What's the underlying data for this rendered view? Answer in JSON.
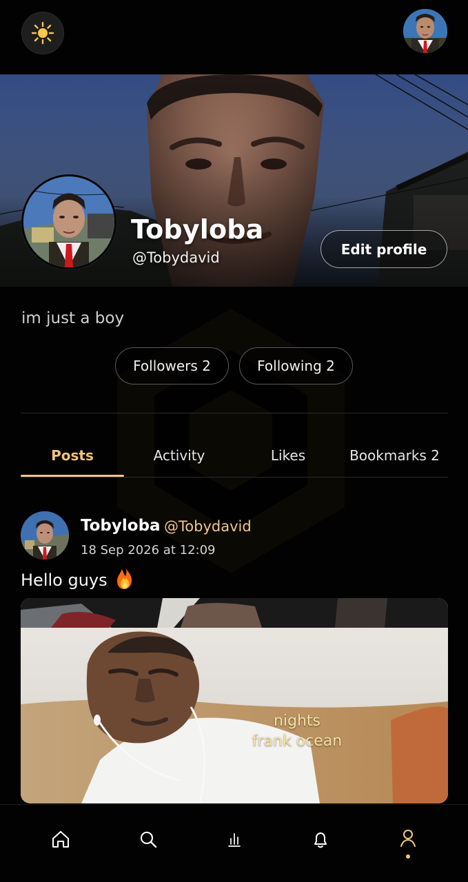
{
  "profile": {
    "display_name": "Tobyloba",
    "handle": "@Tobydavid",
    "bio": "im just a boy",
    "edit_label": "Edit profile",
    "followers_label": "Followers 2",
    "following_label": "Following 2"
  },
  "tabs": [
    {
      "label": "Posts",
      "active": true
    },
    {
      "label": "Activity",
      "active": false
    },
    {
      "label": "Likes",
      "active": false
    },
    {
      "label": "Bookmarks 2",
      "active": false
    }
  ],
  "post": {
    "author": "Tobyloba",
    "handle": "@Tobydavid",
    "timestamp": "18 Sep 2026 at 12:09",
    "text": "Hello guys",
    "media_caption": "nights\nfrank ocean"
  },
  "theme": {
    "background": "#020202",
    "accent": "#f1c57f",
    "muted_text": "#d2d2d2"
  },
  "icons": {
    "theme": "sun-icon",
    "home": "home-icon",
    "search": "search-icon",
    "stats": "stats-icon",
    "notifications": "bell-icon",
    "profile": "profile-icon",
    "fire": "fire-icon"
  }
}
